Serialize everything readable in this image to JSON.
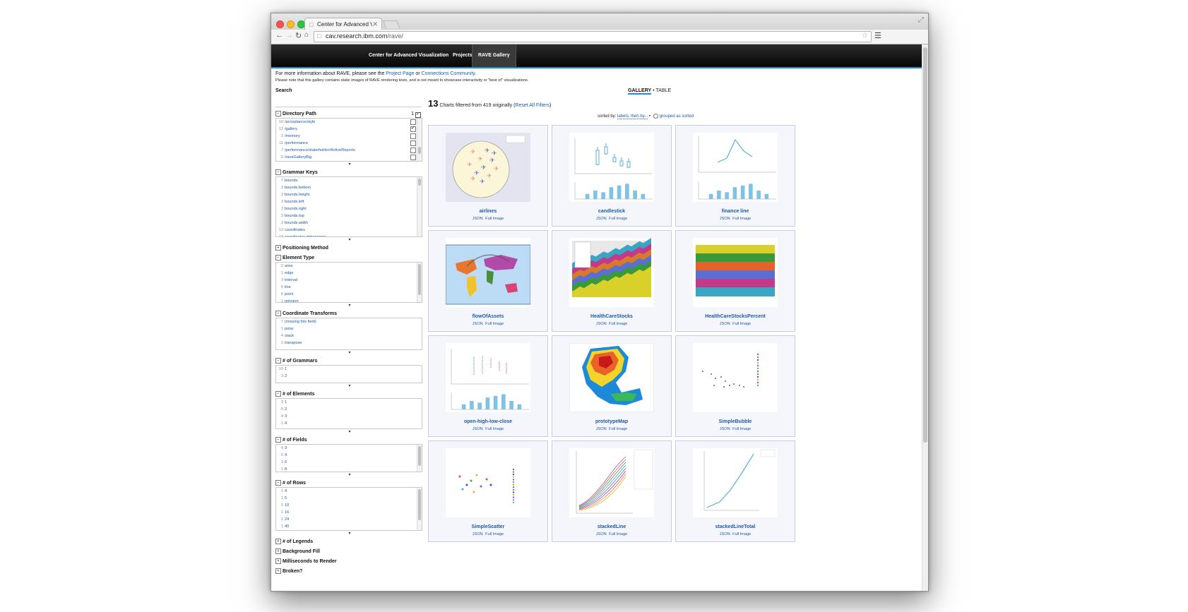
{
  "browser": {
    "tab_title": "Center for Advanced Visua",
    "url_host": "cav.research.ibm.com",
    "url_path": "/rave/"
  },
  "nav": {
    "items": [
      {
        "label": "Center for Advanced Visualization"
      },
      {
        "label": "Projects"
      },
      {
        "label": "RAVE Gallery"
      }
    ]
  },
  "intro": {
    "prefix": "For more information about RAVE, please see the ",
    "project_link": "Project Page",
    "or": " or ",
    "community_link": "Connections Community",
    "suffix": ".",
    "note": "Please note that this gallery contains static images of RAVE rendering tests, and is not meant to showcase interactivity or \"best of\" visualizations."
  },
  "search": {
    "label": "Search",
    "value": ""
  },
  "facets": {
    "directory_path": {
      "title": "Directory Path",
      "selected_count": "1",
      "items": [
        {
          "count": "10",
          "label": "/acceptance/style",
          "checked": false
        },
        {
          "count": "13",
          "label": "/gallery",
          "checked": true
        },
        {
          "count": "3",
          "label": "/memory",
          "checked": false
        },
        {
          "count": "11",
          "label": "/performance",
          "checked": false
        },
        {
          "count": "7",
          "label": "/performance/stakeholder/ActiveReports",
          "checked": false
        },
        {
          "count": "2",
          "label": "/raveGalleryBig",
          "checked": false
        }
      ]
    },
    "grammar_keys": {
      "title": "Grammar Keys",
      "items": [
        {
          "count": "7",
          "label": "bounds"
        },
        {
          "count": "3",
          "label": "bounds.bottom"
        },
        {
          "count": "3",
          "label": "bounds.height"
        },
        {
          "count": "3",
          "label": "bounds.left"
        },
        {
          "count": "3",
          "label": "bounds.right"
        },
        {
          "count": "3",
          "label": "bounds.top"
        },
        {
          "count": "3",
          "label": "bounds.width"
        },
        {
          "count": "13",
          "label": "coordinates"
        },
        {
          "count": "13",
          "label": "coordinates.dimensions"
        }
      ]
    },
    "positioning_method": {
      "title": "Positioning Method"
    },
    "element_type": {
      "title": "Element Type",
      "items": [
        {
          "count": "2",
          "label": "area"
        },
        {
          "count": "1",
          "label": "edge"
        },
        {
          "count": "3",
          "label": "interval"
        },
        {
          "count": "5",
          "label": "line"
        },
        {
          "count": "6",
          "label": "point"
        },
        {
          "count": "1",
          "label": "polygon"
        }
      ]
    },
    "coordinate_transforms": {
      "title": "Coordinate Transforms",
      "items": [
        {
          "count": "7",
          "label": "(missing this field)"
        },
        {
          "count": "1",
          "label": "polar"
        },
        {
          "count": "4",
          "label": "stack"
        },
        {
          "count": "1",
          "label": "transpose"
        }
      ]
    },
    "num_grammars": {
      "title": "# of Grammars",
      "items": [
        {
          "count": "10",
          "label": "1"
        },
        {
          "count": "3",
          "label": "2"
        }
      ]
    },
    "num_elements": {
      "title": "# of Elements",
      "items": [
        {
          "count": "3",
          "label": "1"
        },
        {
          "count": "5",
          "label": "2"
        },
        {
          "count": "4",
          "label": "3"
        },
        {
          "count": "1",
          "label": "4"
        }
      ]
    },
    "num_fields": {
      "title": "# of Fields",
      "items": [
        {
          "count": "4",
          "label": "3"
        },
        {
          "count": "5",
          "label": "4"
        },
        {
          "count": "3",
          "label": "6"
        },
        {
          "count": "1",
          "label": "8"
        }
      ]
    },
    "num_rows": {
      "title": "# of Rows",
      "items": [
        {
          "count": "1",
          "label": "4"
        },
        {
          "count": "1",
          "label": "5"
        },
        {
          "count": "1",
          "label": "10"
        },
        {
          "count": "1",
          "label": "16"
        },
        {
          "count": "1",
          "label": "24"
        },
        {
          "count": "1",
          "label": "40"
        }
      ]
    },
    "num_legends": {
      "title": "# of Legends"
    },
    "background_fill": {
      "title": "Background Fill"
    },
    "ms_to_render": {
      "title": "Milliseconds to Render"
    },
    "broken": {
      "title": "Broken?"
    }
  },
  "gallery": {
    "view_gallery": "GALLERY",
    "view_sep": " • ",
    "view_table": "TABLE",
    "count": "13",
    "filtered_text": " Charts filtered from 419 originally (",
    "reset_link": "Reset All Filters",
    "close_paren": ")",
    "sorted_prefix": "sorted by: ",
    "sort_link": "labels; then by...",
    "sort_sep": " • ",
    "grouped": "grouped as sorted",
    "json_label": "JSON",
    "full_label": "Full Image",
    "cards": [
      {
        "title": "airlines",
        "kind": "airlines"
      },
      {
        "title": "candlestick",
        "kind": "candlestick"
      },
      {
        "title": "finance line",
        "kind": "financeline"
      },
      {
        "title": "flowOfAssets",
        "kind": "flow"
      },
      {
        "title": "HealthCareStocks",
        "kind": "stocks"
      },
      {
        "title": "HealthCareStocksPercent",
        "kind": "stockspct"
      },
      {
        "title": "open-high-low-close",
        "kind": "ohlc"
      },
      {
        "title": "prototypeMap",
        "kind": "map"
      },
      {
        "title": "SimpleBubble",
        "kind": "bubble"
      },
      {
        "title": "SimpleScatter",
        "kind": "scatter"
      },
      {
        "title": "stackedLine",
        "kind": "stackedline"
      },
      {
        "title": "stackedLineTotal",
        "kind": "stackedtotal"
      }
    ]
  },
  "colors": {
    "nav_accent": "#1a8fd1",
    "link": "#1b5aa6",
    "card_bg": "#f5f6fc"
  }
}
